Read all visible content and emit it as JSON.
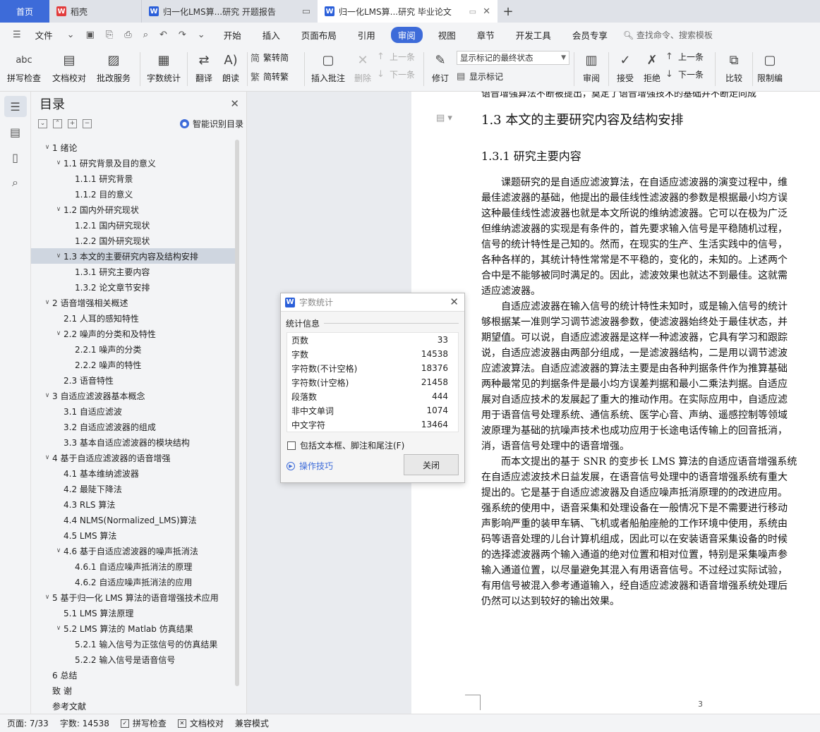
{
  "tabs": {
    "home": "首页",
    "daoke": "稻壳",
    "doc1": "归一化LMS算...研究 开题报告",
    "doc2": "归一化LMS算...研究 毕业论文"
  },
  "menu": {
    "file": "文件",
    "items": [
      "开始",
      "插入",
      "页面布局",
      "引用",
      "审阅",
      "视图",
      "章节",
      "开发工具",
      "会员专享"
    ],
    "search": "查找命令、搜索模板"
  },
  "ribbon": {
    "spell": "拼写检查",
    "proofread": "文档校对",
    "annotate_service": "批改服务",
    "wordcount": "字数统计",
    "translate": "翻译",
    "read": "朗读",
    "trad": "繁转简",
    "simp": "简转繁",
    "insert_comment": "插入批注",
    "delete": "删除",
    "prev": "上一条",
    "next": "下一条",
    "revise": "修订",
    "track_state": "显示标记的最终状态",
    "show_marks": "显示标记",
    "review": "审阅",
    "accept": "接受",
    "reject": "拒绝",
    "prev2": "上一条",
    "next2": "下一条",
    "compare": "比较",
    "restrict": "限制编"
  },
  "toc": {
    "title": "目录",
    "smart": "智能识别目录",
    "items": [
      "1 绪论",
      "1.1 研究背景及目的意义",
      "1.1.1 研究背景",
      "1.1.2 目的意义",
      "1.2 国内外研究现状",
      "1.2.1 国内研究现状",
      "1.2.2 国外研究现状",
      "1.3 本文的主要研究内容及结构安排",
      "1.3.1 研究主要内容",
      "1.3.2 论文章节安排",
      "2 语音增强相关概述",
      "2.1 人耳的感知特性",
      "2.2 噪声的分类和及特性",
      "2.2.1 噪声的分类",
      "2.2.2 噪声的特性",
      "2.3 语音特性",
      "3 自适应滤波器基本概念",
      "3.1 自适应滤波",
      "3.2 自适应滤波器的组成",
      "3.3 基本自适应滤波器的模块结构",
      "4 基于自适应滤波器的语音增强",
      "4.1 基本维纳滤波器",
      "4.2 最陡下降法",
      "4.3 RLS 算法",
      "4.4 NLMS(Normalized_LMS)算法",
      "4.5 LMS 算法",
      "4.6 基于自适应滤波器的噪声抵消法",
      "4.6.1 自适应噪声抵消法的原理",
      "4.6.2 自适应噪声抵消法的应用",
      "5 基于归一化 LMS 算法的语音增强技术应用",
      "5.1 LMS 算法原理",
      "5.2 LMS 算法的 Matlab 仿真结果",
      "5.2.1 输入信号为正弦信号的仿真结果",
      "5.2.2 输入信号是语音信号",
      "6 总结",
      "致 谢",
      "参考文献"
    ]
  },
  "doc": {
    "top_cut": "语音增强算法不断被提出，奠定了语音增强技术的基础并不断走向成",
    "heading2": "1.3  本文的主要研究内容及结构安排",
    "heading3": "1.3.1  研究主要内容",
    "lines": [
      "　　课题研究的是自适应滤波算法，在自适应滤波器的演变过程中，维",
      "最佳滤波器的基础，他提出的最佳线性滤波器的参数是根据最小均方误",
      "这种最佳线性滤波器也就是本文所说的维纳滤波器。它可以在极为广泛",
      "但维纳滤波器的实现是有条件的，首先要求输入信号是平稳随机过程，",
      "信号的统计特性是己知的。然而，在现实的生产、生活实践中的信号，",
      "各种各样的，其统计特性常常是不平稳的，变化的，未知的。上述两个",
      "合中是不能够被同时满足的。因此，滤波效果也就达不到最佳。这就需",
      "适应滤波器。",
      "　　自适应滤波器在输入信号的统计特性未知时，或是输入信号的统计",
      "够根据某一准则学习调节滤波器参数，使滤波器始终处于最佳状态，并",
      "期望值。可以说，自适应滤波器是这样一种滤波器，它具有学习和跟踪",
      "说，自适应滤波器由两部分组成，一是滤波器结构，二是用以调节滤波",
      "应滤波算法。自适应滤波器的算法主要是由各种判据条件作为推算基础",
      "两种最常见的判据条件是最小均方误差判据和最小二乘法判据。自适应",
      "展对自适应技术的发展起了重大的推动作用。在实际应用中，自适应滤",
      "用于语音信号处理系统、通信系统、医学心音、声纳、遥感控制等领域",
      "波原理为基础的抗噪声技术也成功应用于长途电话传输上的回音抵消，",
      "消，语音信号处理中的语音增强。",
      "　　而本文提出的基于 SNR 的变步长 LMS 算法的自适应语音增强系统",
      "在自适应滤波技术日益发展，在语音信号处理中的语音增强系统有重大",
      "提出的。它是基于自适应滤波器及自适应噪声抵消原理的的改进应用。",
      "强系统的使用中，语音采集和处理设备在一般情况下是不需要进行移动",
      "声影响严重的装甲车辆、飞机或者船舶座舱的工作环境中使用，系统由",
      "码等语音处理的儿台计算机组成，因此可以在安装语音采集设备的时候",
      "的选择滤波器两个输入通道的绝对位置和相对位置，特别是采集噪声参",
      "输入通道位置，以尽量避免其混入有用语音信号。不过经过实际试验，",
      "有用信号被混入参考通道输入，经自适应滤波器和语音增强系统处理后",
      "仍然可以达到较好的输出效果。"
    ],
    "page_number": "3"
  },
  "dialog": {
    "title": "字数统计",
    "section": "统计信息",
    "rows": [
      {
        "label": "页数",
        "value": "33"
      },
      {
        "label": "字数",
        "value": "14538"
      },
      {
        "label": "字符数(不计空格)",
        "value": "18376"
      },
      {
        "label": "字符数(计空格)",
        "value": "21458"
      },
      {
        "label": "段落数",
        "value": "444"
      },
      {
        "label": "非中文单词",
        "value": "1074"
      },
      {
        "label": "中文字符",
        "value": "13464"
      }
    ],
    "include": "包括文本框、脚注和尾注(F)",
    "tips": "操作技巧",
    "close": "关闭"
  },
  "status": {
    "page": "页面: 7/33",
    "words": "字数: 14538",
    "spell": "拼写检查",
    "proof": "文档校对",
    "compat": "兼容模式"
  }
}
